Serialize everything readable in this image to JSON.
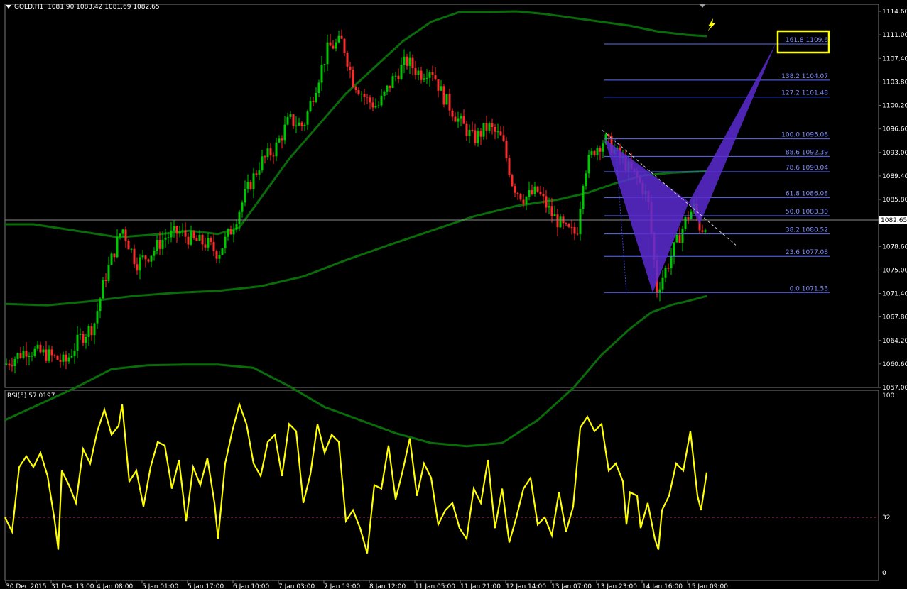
{
  "window": {
    "symbol": "GOLD,H1",
    "ohlc": "1081.90 1083.42 1081.69 1082.65"
  },
  "colors": {
    "background": "#000000",
    "bull": "#00c800",
    "bear": "#ff2a2a",
    "bands": "#0a6b0a",
    "pattern": "#5b2bd1",
    "rsi": "#ffff00",
    "fib": "#5a6cff",
    "highlight": "#ffff00"
  },
  "price_axis": {
    "labels": [
      "1114.60",
      "1111.00",
      "1107.40",
      "1103.80",
      "1100.20",
      "1096.60",
      "1093.00",
      "1089.40",
      "1085.80",
      "1082.65",
      "1078.60",
      "1075.00",
      "1071.40",
      "1067.80",
      "1064.20",
      "1060.60",
      "1057.00"
    ],
    "current": "1082.65"
  },
  "time_axis": {
    "labels": [
      "30 Dec 2015",
      "31 Dec 13:00",
      "4 Jan 08:00",
      "5 Jan 01:00",
      "5 Jan 17:00",
      "6 Jan 10:00",
      "7 Jan 03:00",
      "7 Jan 19:00",
      "8 Jan 12:00",
      "11 Jan 05:00",
      "11 Jan 21:00",
      "12 Jan 14:00",
      "13 Jan 07:00",
      "13 Jan 23:00",
      "14 Jan 16:00",
      "15 Jan 09:00"
    ]
  },
  "fib_levels": [
    {
      "ratio": "161.8",
      "price": "1109.6"
    },
    {
      "ratio": "138.2",
      "price": "1104.07"
    },
    {
      "ratio": "127.2",
      "price": "1101.48"
    },
    {
      "ratio": "100.0",
      "price": "1095.08"
    },
    {
      "ratio": "88.6",
      "price": "1092.39"
    },
    {
      "ratio": "78.6",
      "price": "1090.04"
    },
    {
      "ratio": "61.8",
      "price": "1086.08"
    },
    {
      "ratio": "50.0",
      "price": "1083.30"
    },
    {
      "ratio": "38.2",
      "price": "1080.52"
    },
    {
      "ratio": "23.6",
      "price": "1077.08"
    },
    {
      "ratio": "0.0",
      "price": "1071.53"
    }
  ],
  "rsi": {
    "label": "RSI(5) 57.0197",
    "axis_labels": [
      "100",
      "32",
      "0"
    ],
    "level": 32
  },
  "chart_data": {
    "type": "candlestick",
    "symbol": "GOLD",
    "timeframe": "H1",
    "ylim": [
      1057.0,
      1114.6
    ],
    "close_path": [
      [
        0,
        1060.5
      ],
      [
        30,
        1062.8
      ],
      [
        60,
        1062.0
      ],
      [
        85,
        1060.8
      ],
      [
        105,
        1064.5
      ],
      [
        125,
        1066.5
      ],
      [
        140,
        1073.5
      ],
      [
        165,
        1081.5
      ],
      [
        185,
        1076.0
      ],
      [
        205,
        1077.5
      ],
      [
        225,
        1080.0
      ],
      [
        245,
        1080.8
      ],
      [
        265,
        1079.5
      ],
      [
        285,
        1079.0
      ],
      [
        300,
        1077.5
      ],
      [
        320,
        1081.5
      ],
      [
        340,
        1087.0
      ],
      [
        360,
        1091.5
      ],
      [
        380,
        1093.5
      ],
      [
        400,
        1098.0
      ],
      [
        420,
        1097.0
      ],
      [
        440,
        1104.0
      ],
      [
        455,
        1109.0
      ],
      [
        475,
        1110.0
      ],
      [
        490,
        1104.0
      ],
      [
        510,
        1101.0
      ],
      [
        525,
        1100.0
      ],
      [
        545,
        1104.0
      ],
      [
        565,
        1107.0
      ],
      [
        585,
        1105.0
      ],
      [
        600,
        1106.0
      ],
      [
        615,
        1102.0
      ],
      [
        635,
        1098.5
      ],
      [
        660,
        1095.0
      ],
      [
        680,
        1097.0
      ],
      [
        700,
        1095.0
      ],
      [
        715,
        1088.0
      ],
      [
        730,
        1086.0
      ],
      [
        750,
        1087.0
      ],
      [
        770,
        1083.5
      ],
      [
        790,
        1081.0
      ],
      [
        805,
        1080.5
      ],
      [
        815,
        1090.0
      ],
      [
        830,
        1093.5
      ],
      [
        845,
        1095.0
      ],
      [
        860,
        1093.0
      ],
      [
        875,
        1091.0
      ],
      [
        890,
        1089.0
      ],
      [
        905,
        1086.0
      ],
      [
        918,
        1072.0
      ],
      [
        930,
        1075.0
      ],
      [
        945,
        1079.0
      ],
      [
        960,
        1083.0
      ],
      [
        970,
        1084.5
      ],
      [
        980,
        1081.0
      ],
      [
        988,
        1082.65
      ]
    ],
    "series": [
      {
        "name": "upper-band",
        "x": [
          0,
          40,
          100,
          160,
          220,
          260,
          300,
          330,
          360,
          400,
          440,
          480,
          520,
          560,
          600,
          640,
          680,
          720,
          760,
          800,
          840,
          880,
          920,
          960,
          988
        ],
        "y": [
          1082.0,
          1082.0,
          1081.0,
          1080.0,
          1080.5,
          1081.0,
          1080.5,
          1081.5,
          1086.0,
          1092.0,
          1097.0,
          1102.0,
          1106.0,
          1110.0,
          1113.0,
          1114.5,
          1114.5,
          1114.6,
          1114.2,
          1113.6,
          1113.0,
          1112.4,
          1111.5,
          1111.0,
          1110.8
        ]
      },
      {
        "name": "middle-band",
        "x": [
          0,
          60,
          120,
          180,
          240,
          300,
          360,
          420,
          480,
          540,
          600,
          660,
          720,
          780,
          820,
          860,
          900,
          940,
          988
        ],
        "y": [
          1069.8,
          1069.6,
          1070.2,
          1071.0,
          1071.5,
          1071.8,
          1072.5,
          1074.0,
          1076.5,
          1078.8,
          1081.0,
          1083.2,
          1084.8,
          1085.8,
          1086.8,
          1088.3,
          1089.5,
          1089.9,
          1090.1
        ]
      },
      {
        "name": "lower-band",
        "x": [
          0,
          100,
          150,
          200,
          250,
          300,
          350,
          400,
          450,
          500,
          550,
          600,
          650,
          700,
          750,
          800,
          840,
          880,
          910,
          940,
          960,
          988
        ],
        "y": [
          1052.0,
          1057.0,
          1059.8,
          1060.4,
          1060.5,
          1060.5,
          1060.0,
          1057.2,
          1054.0,
          1052.0,
          1050.0,
          1048.5,
          1048.0,
          1048.5,
          1052.0,
          1056.9,
          1062.0,
          1066.0,
          1068.5,
          1069.7,
          1070.2,
          1071.0
        ]
      }
    ],
    "rsi_path": [
      [
        0,
        32
      ],
      [
        10,
        24
      ],
      [
        20,
        60
      ],
      [
        30,
        66
      ],
      [
        40,
        60
      ],
      [
        50,
        68
      ],
      [
        60,
        55
      ],
      [
        70,
        30
      ],
      [
        75,
        14
      ],
      [
        80,
        58
      ],
      [
        90,
        50
      ],
      [
        100,
        40
      ],
      [
        110,
        70
      ],
      [
        120,
        62
      ],
      [
        130,
        80
      ],
      [
        140,
        92
      ],
      [
        150,
        78
      ],
      [
        160,
        83
      ],
      [
        165,
        95
      ],
      [
        175,
        52
      ],
      [
        185,
        58
      ],
      [
        195,
        38
      ],
      [
        205,
        60
      ],
      [
        215,
        74
      ],
      [
        225,
        72
      ],
      [
        235,
        48
      ],
      [
        245,
        64
      ],
      [
        255,
        30
      ],
      [
        265,
        60
      ],
      [
        275,
        50
      ],
      [
        285,
        65
      ],
      [
        295,
        40
      ],
      [
        300,
        20
      ],
      [
        310,
        62
      ],
      [
        320,
        80
      ],
      [
        330,
        95
      ],
      [
        340,
        84
      ],
      [
        350,
        62
      ],
      [
        360,
        55
      ],
      [
        370,
        74
      ],
      [
        380,
        78
      ],
      [
        390,
        55
      ],
      [
        400,
        84
      ],
      [
        410,
        80
      ],
      [
        420,
        40
      ],
      [
        430,
        56
      ],
      [
        440,
        84
      ],
      [
        450,
        68
      ],
      [
        460,
        78
      ],
      [
        470,
        74
      ],
      [
        480,
        30
      ],
      [
        490,
        36
      ],
      [
        500,
        26
      ],
      [
        510,
        12
      ],
      [
        520,
        50
      ],
      [
        530,
        48
      ],
      [
        540,
        72
      ],
      [
        550,
        42
      ],
      [
        560,
        58
      ],
      [
        570,
        76
      ],
      [
        580,
        44
      ],
      [
        590,
        62
      ],
      [
        600,
        54
      ],
      [
        610,
        28
      ],
      [
        620,
        36
      ],
      [
        630,
        40
      ],
      [
        640,
        26
      ],
      [
        650,
        20
      ],
      [
        660,
        48
      ],
      [
        670,
        40
      ],
      [
        680,
        64
      ],
      [
        690,
        26
      ],
      [
        700,
        48
      ],
      [
        710,
        18
      ],
      [
        720,
        32
      ],
      [
        730,
        48
      ],
      [
        740,
        54
      ],
      [
        750,
        28
      ],
      [
        760,
        32
      ],
      [
        770,
        22
      ],
      [
        780,
        46
      ],
      [
        790,
        24
      ],
      [
        800,
        38
      ],
      [
        810,
        82
      ],
      [
        820,
        88
      ],
      [
        830,
        80
      ],
      [
        840,
        84
      ],
      [
        850,
        58
      ],
      [
        860,
        62
      ],
      [
        870,
        52
      ],
      [
        875,
        28
      ],
      [
        880,
        46
      ],
      [
        890,
        44
      ],
      [
        895,
        26
      ],
      [
        905,
        40
      ],
      [
        915,
        20
      ],
      [
        920,
        14
      ],
      [
        925,
        36
      ],
      [
        935,
        44
      ],
      [
        945,
        62
      ],
      [
        955,
        58
      ],
      [
        965,
        80
      ],
      [
        975,
        44
      ],
      [
        980,
        36
      ],
      [
        988,
        57
      ]
    ],
    "annotations": [
      "bullish bat harmonic pattern",
      "161.8 1109.6 target highlighted",
      "descending dashed trendline"
    ]
  }
}
